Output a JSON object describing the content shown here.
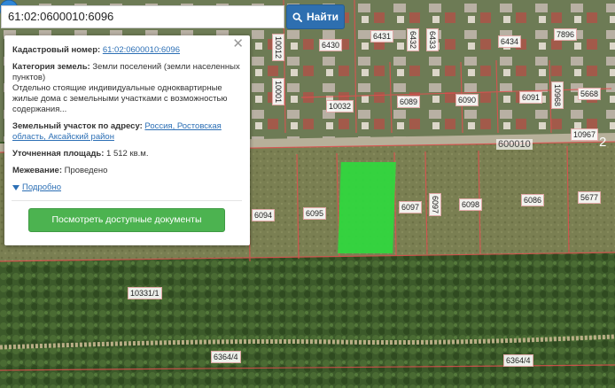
{
  "search": {
    "value": "61:02:0600010:6096",
    "button_label": "Найти"
  },
  "popup": {
    "cadastral_label": "Кадастровый номер:",
    "cadastral_number": "61:02:0600010:6096",
    "category_label": "Категория земель:",
    "category_value": "Земли поселений (земли населенных пунктов)",
    "use_description": "Отдельно стоящие индивидуальные одноквартирные жилые дома с земельными участками с возможностью содержания...",
    "address_label": "Земельный участок по адресу:",
    "address_value": "Россия, Ростовская область, Аксайский район",
    "area_label": "Уточненная площадь:",
    "area_value": "1 512 кв.м.",
    "survey_label": "Межевание:",
    "survey_value": "Проведено",
    "more_label": "Подробно",
    "docs_button_label": "Посмотреть доступные документы"
  },
  "map": {
    "quarter_label": "600010",
    "quarter_big": "2",
    "parcels_horizontal": [
      {
        "id": "p6430",
        "text": "6430"
      },
      {
        "id": "p6431",
        "text": "6431"
      },
      {
        "id": "p6434",
        "text": "6434"
      },
      {
        "id": "p7896",
        "text": "7896"
      },
      {
        "id": "p10032",
        "text": "10032"
      },
      {
        "id": "p6089",
        "text": "6089"
      },
      {
        "id": "p6090",
        "text": "6090"
      },
      {
        "id": "p6091",
        "text": "6091"
      },
      {
        "id": "p5668",
        "text": "5668"
      },
      {
        "id": "p10967",
        "text": "10967"
      },
      {
        "id": "p6094",
        "text": "6094"
      },
      {
        "id": "p6095",
        "text": "6095"
      },
      {
        "id": "p6097",
        "text": "6097"
      },
      {
        "id": "p6098",
        "text": "6098"
      },
      {
        "id": "p6086",
        "text": "6086"
      },
      {
        "id": "p5677",
        "text": "5677"
      },
      {
        "id": "p10331",
        "text": "10331/1"
      },
      {
        "id": "p6364a",
        "text": "6364/4"
      },
      {
        "id": "p6364b",
        "text": "6364/4"
      }
    ],
    "parcels_vertical": [
      {
        "id": "v10012",
        "text": "10012"
      },
      {
        "id": "v6432",
        "text": "6432"
      },
      {
        "id": "v6433",
        "text": "6433"
      },
      {
        "id": "v10001",
        "text": "10001"
      },
      {
        "id": "v10968",
        "text": "10968"
      },
      {
        "id": "v6097",
        "text": "6097"
      }
    ]
  },
  "colors": {
    "selected_parcel": "#2fd93e",
    "marker": "#2f86d6",
    "search_button": "#2e6fb0",
    "docs_button": "#4cb350",
    "parcel_border": "#e05050"
  }
}
